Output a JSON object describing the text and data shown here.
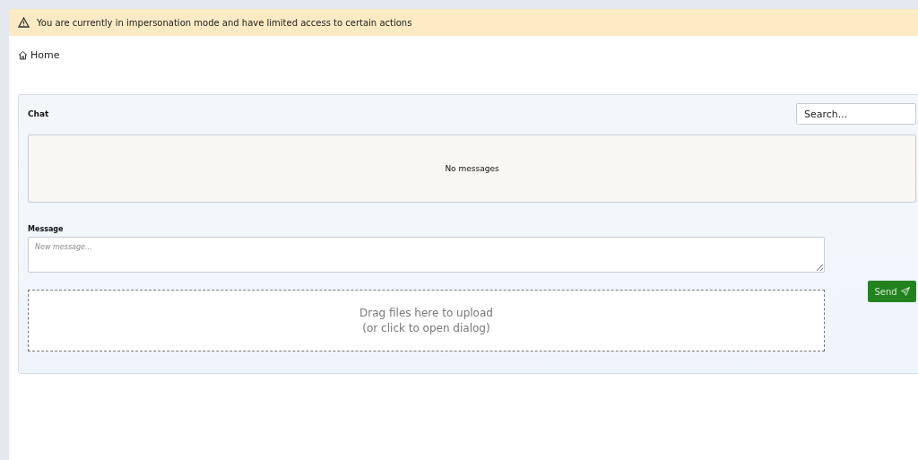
{
  "banner": {
    "text": "You are currently in impersonation mode and have limited access to certain actions"
  },
  "breadcrumb": {
    "label": "Home"
  },
  "chat": {
    "title": "Chat",
    "search": {
      "placeholder": "Search..."
    },
    "empty_text": "No messages",
    "message_label": "Message",
    "message_field": {
      "placeholder": "New message..."
    },
    "dropzone": {
      "line_1": "Drag files here to upload",
      "line_2": "(or click to open dialog)"
    },
    "send_button": "Send"
  }
}
